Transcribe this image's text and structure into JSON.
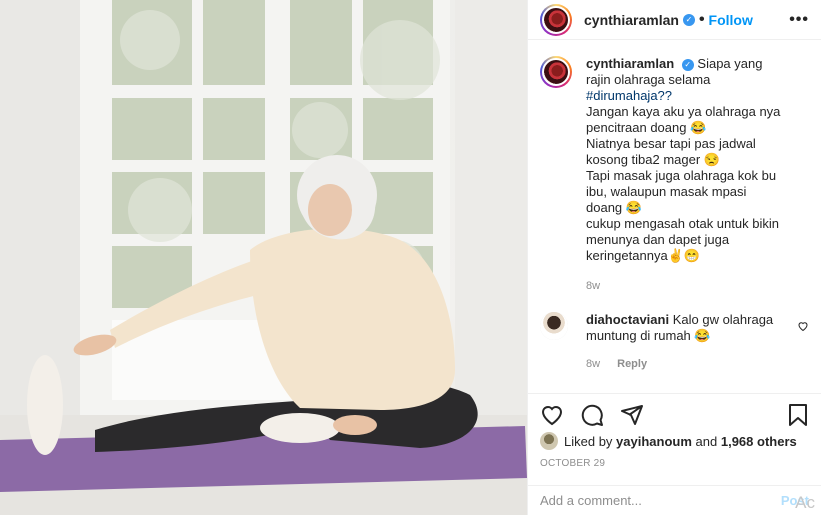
{
  "post": {
    "username": "cynthiaramlan",
    "follow_label": "Follow",
    "dot": "•",
    "more_label": "•••",
    "caption": {
      "username": "cynthiaramlan",
      "first": "Siapa yang rajin olahraga selama",
      "hashtag": "#dirumahaja??",
      "lines": [
        "Jangan kaya aku ya olahraga nya pencitraan doang 😂",
        "Niatnya besar tapi pas jadwal kosong tiba2 mager 😒",
        "Tapi masak juga olahraga kok bu ibu, walaupun masak mpasi doang 😂",
        "cukup mengasah otak untuk bikin menunya dan dapet juga keringetannya✌😁"
      ],
      "time": "8w"
    },
    "comment": {
      "username": "diahoctaviani",
      "text": "Kalo gw olahraga muntung di rumah 😂",
      "time": "8w",
      "reply_label": "Reply"
    },
    "likes": {
      "prefix": "Liked by",
      "user": "yayihanoum",
      "and": "and",
      "others": "1,968 others"
    },
    "date": "OCTOBER 29",
    "add_comment_placeholder": "Add a comment...",
    "post_label": "Post",
    "watermark": "Ac"
  },
  "colors": {
    "accent": "#0095f6",
    "hashtag": "#00376b",
    "mat": "#8c6aa6"
  },
  "icons": [
    "verified-icon",
    "heart-icon",
    "comment-icon",
    "share-icon",
    "bookmark-icon",
    "more-icon"
  ]
}
